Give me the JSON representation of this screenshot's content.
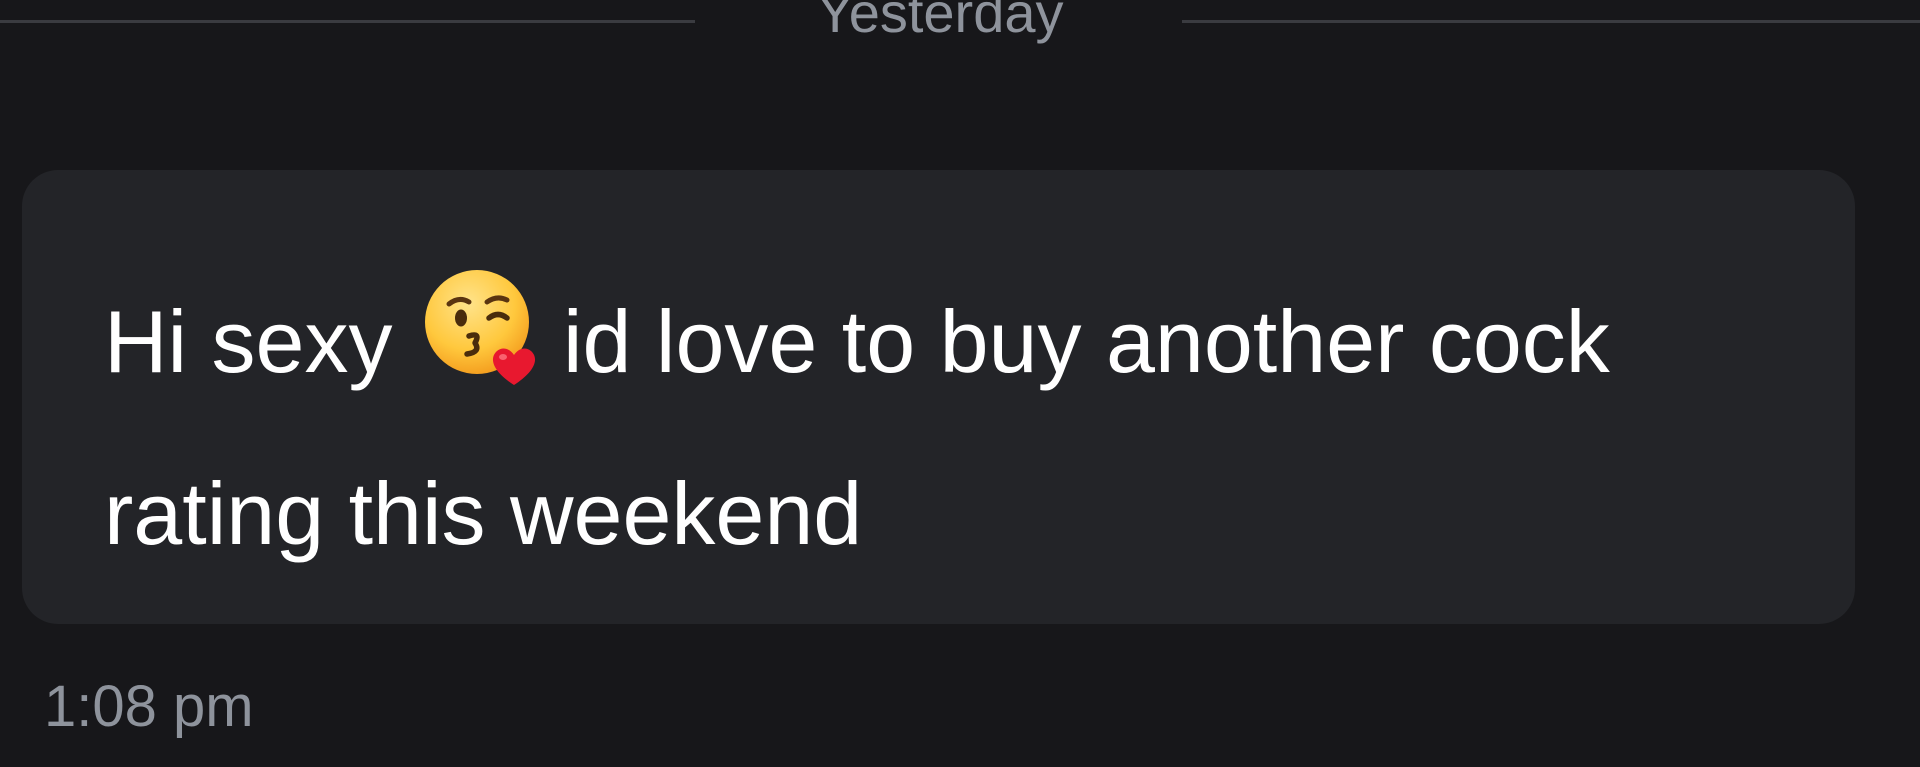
{
  "conversation": {
    "date_divider": "Yesterday",
    "messages": [
      {
        "text_before_emoji": "Hi sexy",
        "emoji": "face-blowing-a-kiss",
        "text_after_emoji": "id love to buy another cock rating this weekend",
        "time": "1:08 pm"
      }
    ]
  },
  "colors": {
    "background": "#17171a",
    "bubble": "#232428",
    "message_text": "#ffffff",
    "muted_text": "#8e939c",
    "divider": "#3a3b40"
  }
}
